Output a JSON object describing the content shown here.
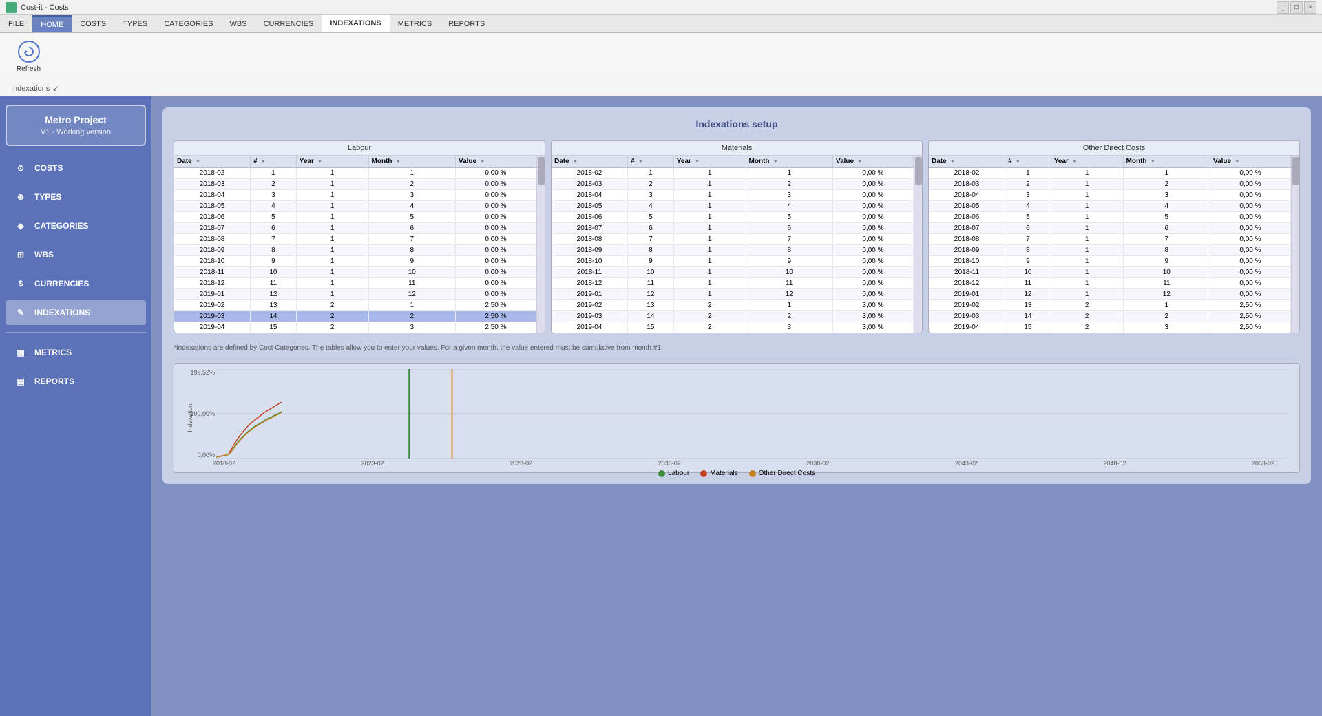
{
  "titleBar": {
    "appName": "Cost-it - Costs",
    "controls": [
      "_",
      "□",
      "×"
    ]
  },
  "menuBar": {
    "items": [
      "FILE",
      "HOME",
      "COSTS",
      "TYPES",
      "CATEGORIES",
      "WBS",
      "CURRENCIES",
      "INDEXATIONS",
      "METRICS",
      "REPORTS"
    ]
  },
  "toolbar": {
    "refreshLabel": "Refresh"
  },
  "breadcrumb": {
    "text": "Indexations"
  },
  "sidebar": {
    "projectName": "Metro Project",
    "projectVersion": "V1 - Working version",
    "items": [
      {
        "id": "costs",
        "label": "COSTS",
        "icon": "⊙"
      },
      {
        "id": "types",
        "label": "TYPES",
        "icon": "⊕"
      },
      {
        "id": "categories",
        "label": "CATEGORIES",
        "icon": "◈"
      },
      {
        "id": "wbs",
        "label": "WBS",
        "icon": "⊞"
      },
      {
        "id": "currencies",
        "label": "CURRENCIES",
        "icon": "$"
      },
      {
        "id": "indexations",
        "label": "INDEXATIONS",
        "icon": "✎",
        "active": true
      },
      {
        "id": "metrics",
        "label": "METRICS",
        "icon": "▦"
      },
      {
        "id": "reports",
        "label": "REPORTS",
        "icon": "▤"
      }
    ]
  },
  "content": {
    "title": "Indexations setup",
    "note": "*Indexations are defined by Cost Categories. The tables allow you to enter your values. For a given month, the value entered must be cumulative from month #1.",
    "tables": [
      {
        "category": "Labour",
        "columns": [
          "Date",
          "#",
          "Year",
          "Month",
          "Value"
        ],
        "rows": [
          {
            "date": "2018-02",
            "num": 1,
            "year": 1,
            "month": 1,
            "value": "0,00 %"
          },
          {
            "date": "2018-03",
            "num": 2,
            "year": 1,
            "month": 2,
            "value": "0,00 %"
          },
          {
            "date": "2018-04",
            "num": 3,
            "year": 1,
            "month": 3,
            "value": "0,00 %"
          },
          {
            "date": "2018-05",
            "num": 4,
            "year": 1,
            "month": 4,
            "value": "0,00 %"
          },
          {
            "date": "2018-06",
            "num": 5,
            "year": 1,
            "month": 5,
            "value": "0,00 %"
          },
          {
            "date": "2018-07",
            "num": 6,
            "year": 1,
            "month": 6,
            "value": "0,00 %"
          },
          {
            "date": "2018-08",
            "num": 7,
            "year": 1,
            "month": 7,
            "value": "0,00 %"
          },
          {
            "date": "2018-09",
            "num": 8,
            "year": 1,
            "month": 8,
            "value": "0,00 %"
          },
          {
            "date": "2018-10",
            "num": 9,
            "year": 1,
            "month": 9,
            "value": "0,00 %"
          },
          {
            "date": "2018-11",
            "num": 10,
            "year": 1,
            "month": 10,
            "value": "0,00 %"
          },
          {
            "date": "2018-12",
            "num": 11,
            "year": 1,
            "month": 11,
            "value": "0,00 %"
          },
          {
            "date": "2019-01",
            "num": 12,
            "year": 1,
            "month": 12,
            "value": "0,00 %"
          },
          {
            "date": "2019-02",
            "num": 13,
            "year": 2,
            "month": 1,
            "value": "2,50 %"
          },
          {
            "date": "2019-03",
            "num": 14,
            "year": 2,
            "month": 2,
            "value": "2,50 %",
            "highlighted": true
          },
          {
            "date": "2019-04",
            "num": 15,
            "year": 2,
            "month": 3,
            "value": "2,50 %"
          }
        ]
      },
      {
        "category": "Materials",
        "columns": [
          "Date",
          "#",
          "Year",
          "Month",
          "Value"
        ],
        "rows": [
          {
            "date": "2018-02",
            "num": 1,
            "year": 1,
            "month": 1,
            "value": "0,00 %"
          },
          {
            "date": "2018-03",
            "num": 2,
            "year": 1,
            "month": 2,
            "value": "0,00 %"
          },
          {
            "date": "2018-04",
            "num": 3,
            "year": 1,
            "month": 3,
            "value": "0,00 %"
          },
          {
            "date": "2018-05",
            "num": 4,
            "year": 1,
            "month": 4,
            "value": "0,00 %"
          },
          {
            "date": "2018-06",
            "num": 5,
            "year": 1,
            "month": 5,
            "value": "0,00 %"
          },
          {
            "date": "2018-07",
            "num": 6,
            "year": 1,
            "month": 6,
            "value": "0,00 %"
          },
          {
            "date": "2018-08",
            "num": 7,
            "year": 1,
            "month": 7,
            "value": "0,00 %"
          },
          {
            "date": "2018-09",
            "num": 8,
            "year": 1,
            "month": 8,
            "value": "0,00 %"
          },
          {
            "date": "2018-10",
            "num": 9,
            "year": 1,
            "month": 9,
            "value": "0,00 %"
          },
          {
            "date": "2018-11",
            "num": 10,
            "year": 1,
            "month": 10,
            "value": "0,00 %"
          },
          {
            "date": "2018-12",
            "num": 11,
            "year": 1,
            "month": 11,
            "value": "0,00 %"
          },
          {
            "date": "2019-01",
            "num": 12,
            "year": 1,
            "month": 12,
            "value": "0,00 %"
          },
          {
            "date": "2019-02",
            "num": 13,
            "year": 2,
            "month": 1,
            "value": "3,00 %"
          },
          {
            "date": "2019-03",
            "num": 14,
            "year": 2,
            "month": 2,
            "value": "3,00 %"
          },
          {
            "date": "2019-04",
            "num": 15,
            "year": 2,
            "month": 3,
            "value": "3,00 %"
          }
        ]
      },
      {
        "category": "Other Direct Costs",
        "columns": [
          "Date",
          "#",
          "Year",
          "Month",
          "Value"
        ],
        "rows": [
          {
            "date": "2018-02",
            "num": 1,
            "year": 1,
            "month": 1,
            "value": "0,00 %"
          },
          {
            "date": "2018-03",
            "num": 2,
            "year": 1,
            "month": 2,
            "value": "0,00 %"
          },
          {
            "date": "2018-04",
            "num": 3,
            "year": 1,
            "month": 3,
            "value": "0,00 %"
          },
          {
            "date": "2018-05",
            "num": 4,
            "year": 1,
            "month": 4,
            "value": "0,00 %"
          },
          {
            "date": "2018-06",
            "num": 5,
            "year": 1,
            "month": 5,
            "value": "0,00 %"
          },
          {
            "date": "2018-07",
            "num": 6,
            "year": 1,
            "month": 6,
            "value": "0,00 %"
          },
          {
            "date": "2018-08",
            "num": 7,
            "year": 1,
            "month": 7,
            "value": "0,00 %"
          },
          {
            "date": "2018-09",
            "num": 8,
            "year": 1,
            "month": 8,
            "value": "0,00 %"
          },
          {
            "date": "2018-10",
            "num": 9,
            "year": 1,
            "month": 9,
            "value": "0,00 %"
          },
          {
            "date": "2018-11",
            "num": 10,
            "year": 1,
            "month": 10,
            "value": "0,00 %"
          },
          {
            "date": "2018-12",
            "num": 11,
            "year": 1,
            "month": 11,
            "value": "0,00 %"
          },
          {
            "date": "2019-01",
            "num": 12,
            "year": 1,
            "month": 12,
            "value": "0,00 %"
          },
          {
            "date": "2019-02",
            "num": 13,
            "year": 2,
            "month": 1,
            "value": "2,50 %"
          },
          {
            "date": "2019-03",
            "num": 14,
            "year": 2,
            "month": 2,
            "value": "2,50 %"
          },
          {
            "date": "2019-04",
            "num": 15,
            "year": 2,
            "month": 3,
            "value": "2,50 %"
          }
        ]
      }
    ],
    "chart": {
      "yLabels": [
        "199,52%",
        "100,00%",
        "0,00%"
      ],
      "xLabels": [
        "2018-02",
        "2023-02",
        "2028-02",
        "2033-02",
        "2038-02",
        "2043-02",
        "2048-02",
        "2053-02"
      ],
      "legend": [
        {
          "label": "Labour",
          "color": "#3a8a3a"
        },
        {
          "label": "Materials",
          "color": "#c04020"
        },
        {
          "label": "Other Direct Costs",
          "color": "#c08020"
        }
      ]
    }
  }
}
